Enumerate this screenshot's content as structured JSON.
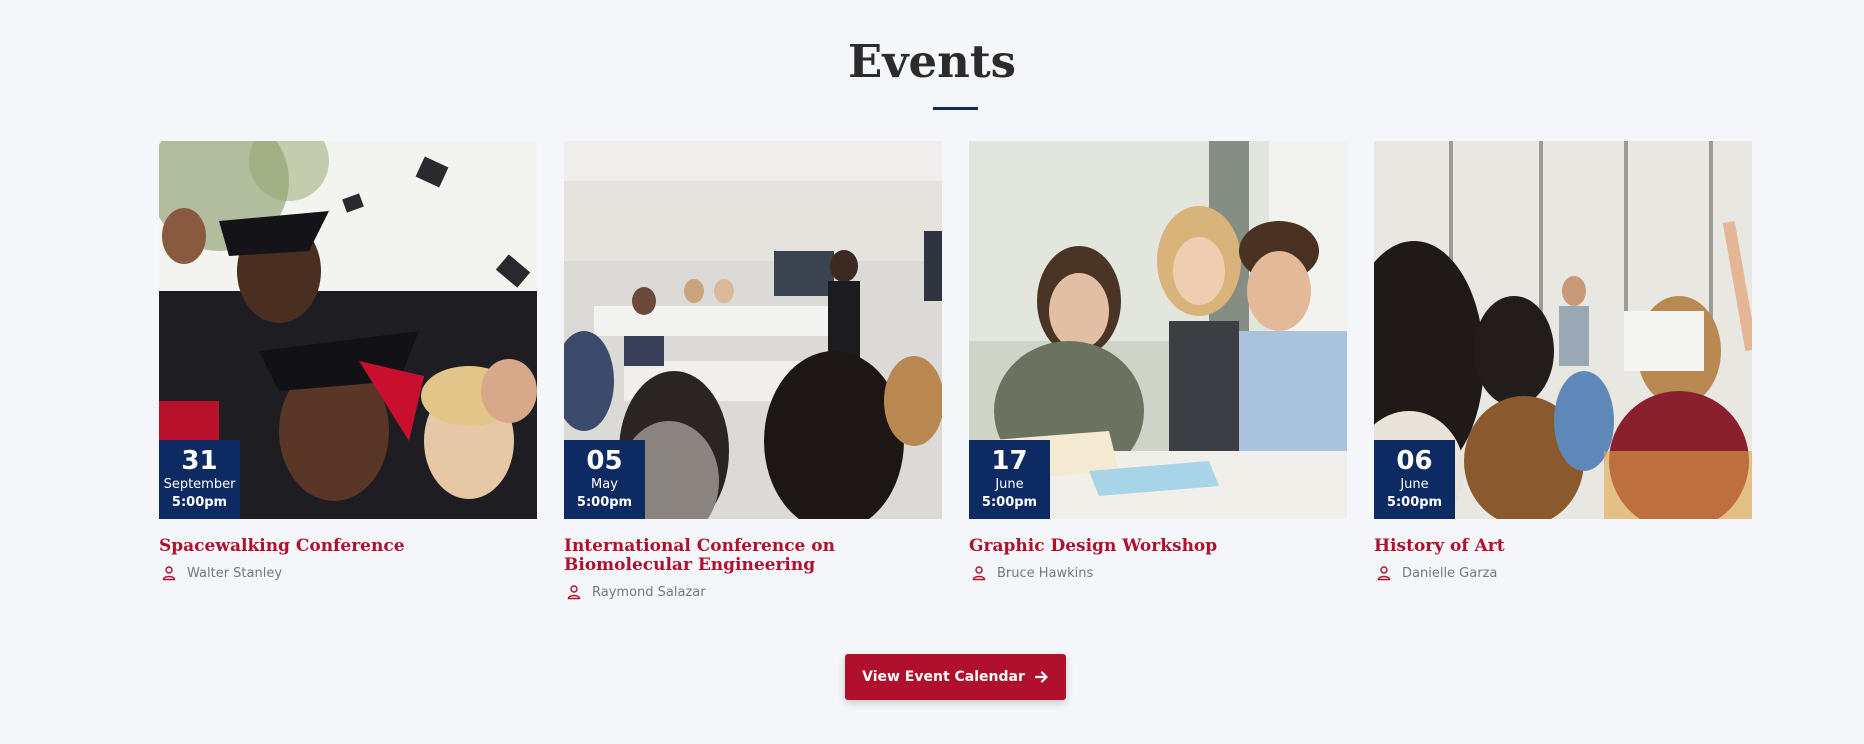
{
  "section": {
    "title": "Events"
  },
  "colors": {
    "accent": "#b0102b",
    "badge": "#0e2a63",
    "underline": "#0d2a63",
    "background": "#f5f6fa"
  },
  "events": [
    {
      "day": "31",
      "month": "September",
      "time": "5:00pm",
      "title": "Spacewalking Conference",
      "organizer": "Walter Stanley",
      "image": "graduates-celebrating-photo"
    },
    {
      "day": "05",
      "month": "May",
      "time": "5:00pm",
      "title": "International Conference on Biomolecular Engineering",
      "organizer": "Raymond Salazar",
      "image": "classroom-lecture-photo"
    },
    {
      "day": "17",
      "month": "June",
      "time": "5:00pm",
      "title": "Graphic Design Workshop",
      "organizer": "Bruce Hawkins",
      "image": "students-studying-photo"
    },
    {
      "day": "06",
      "month": "June",
      "time": "5:00pm",
      "title": "History of Art",
      "organizer": "Danielle Garza",
      "image": "students-raising-hands-photo"
    }
  ],
  "cta": {
    "label": "View Event Calendar",
    "icon": "arrow-right-icon"
  }
}
